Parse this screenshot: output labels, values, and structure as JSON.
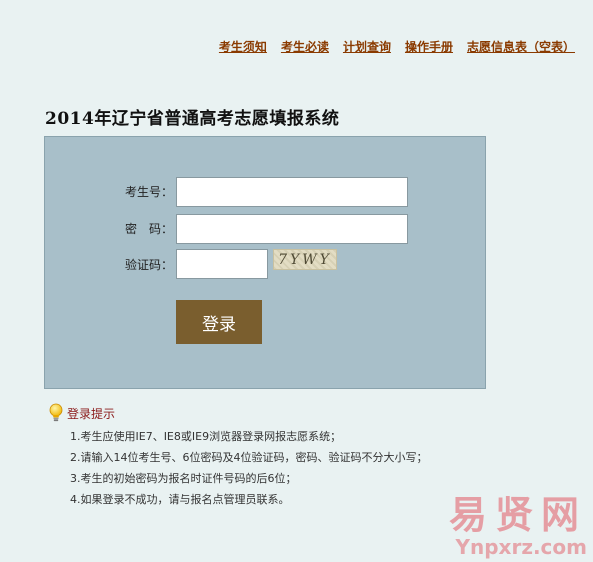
{
  "nav": {
    "items": [
      {
        "label": "考生须知"
      },
      {
        "label": "考生必读"
      },
      {
        "label": "计划查询"
      },
      {
        "label": "操作手册"
      },
      {
        "label": "志愿信息表（空表）"
      }
    ]
  },
  "title": "2014年辽宁省普通高考志愿填报系统",
  "form": {
    "exam_no_label": "考生号：",
    "exam_no_value": "",
    "password_label": "密　码：",
    "password_value": "",
    "captcha_label": "验证码：",
    "captcha_value": "",
    "captcha_text": "7YWY",
    "submit_label": "登录"
  },
  "tips": {
    "icon": "lightbulb-icon",
    "title": "登录提示",
    "items": [
      "1.考生应使用IE7、IE8或IE9浏览器登录网报志愿系统；",
      "2.请输入14位考生号、6位密码及4位验证码，密码、验证码不分大小写；",
      "3.考生的初始密码为报名时证件号码的后6位；",
      "4.如果登录不成功，请与报名点管理员联系。"
    ]
  },
  "watermark": {
    "cn": "易贤网",
    "en": "Ynpxrz.com"
  },
  "colors": {
    "background": "#e9f2f2",
    "panel": "#a8bfc9",
    "nav_link": "#8a3a00",
    "button": "#7a5e2e",
    "tips_title": "#8b1a1a"
  }
}
